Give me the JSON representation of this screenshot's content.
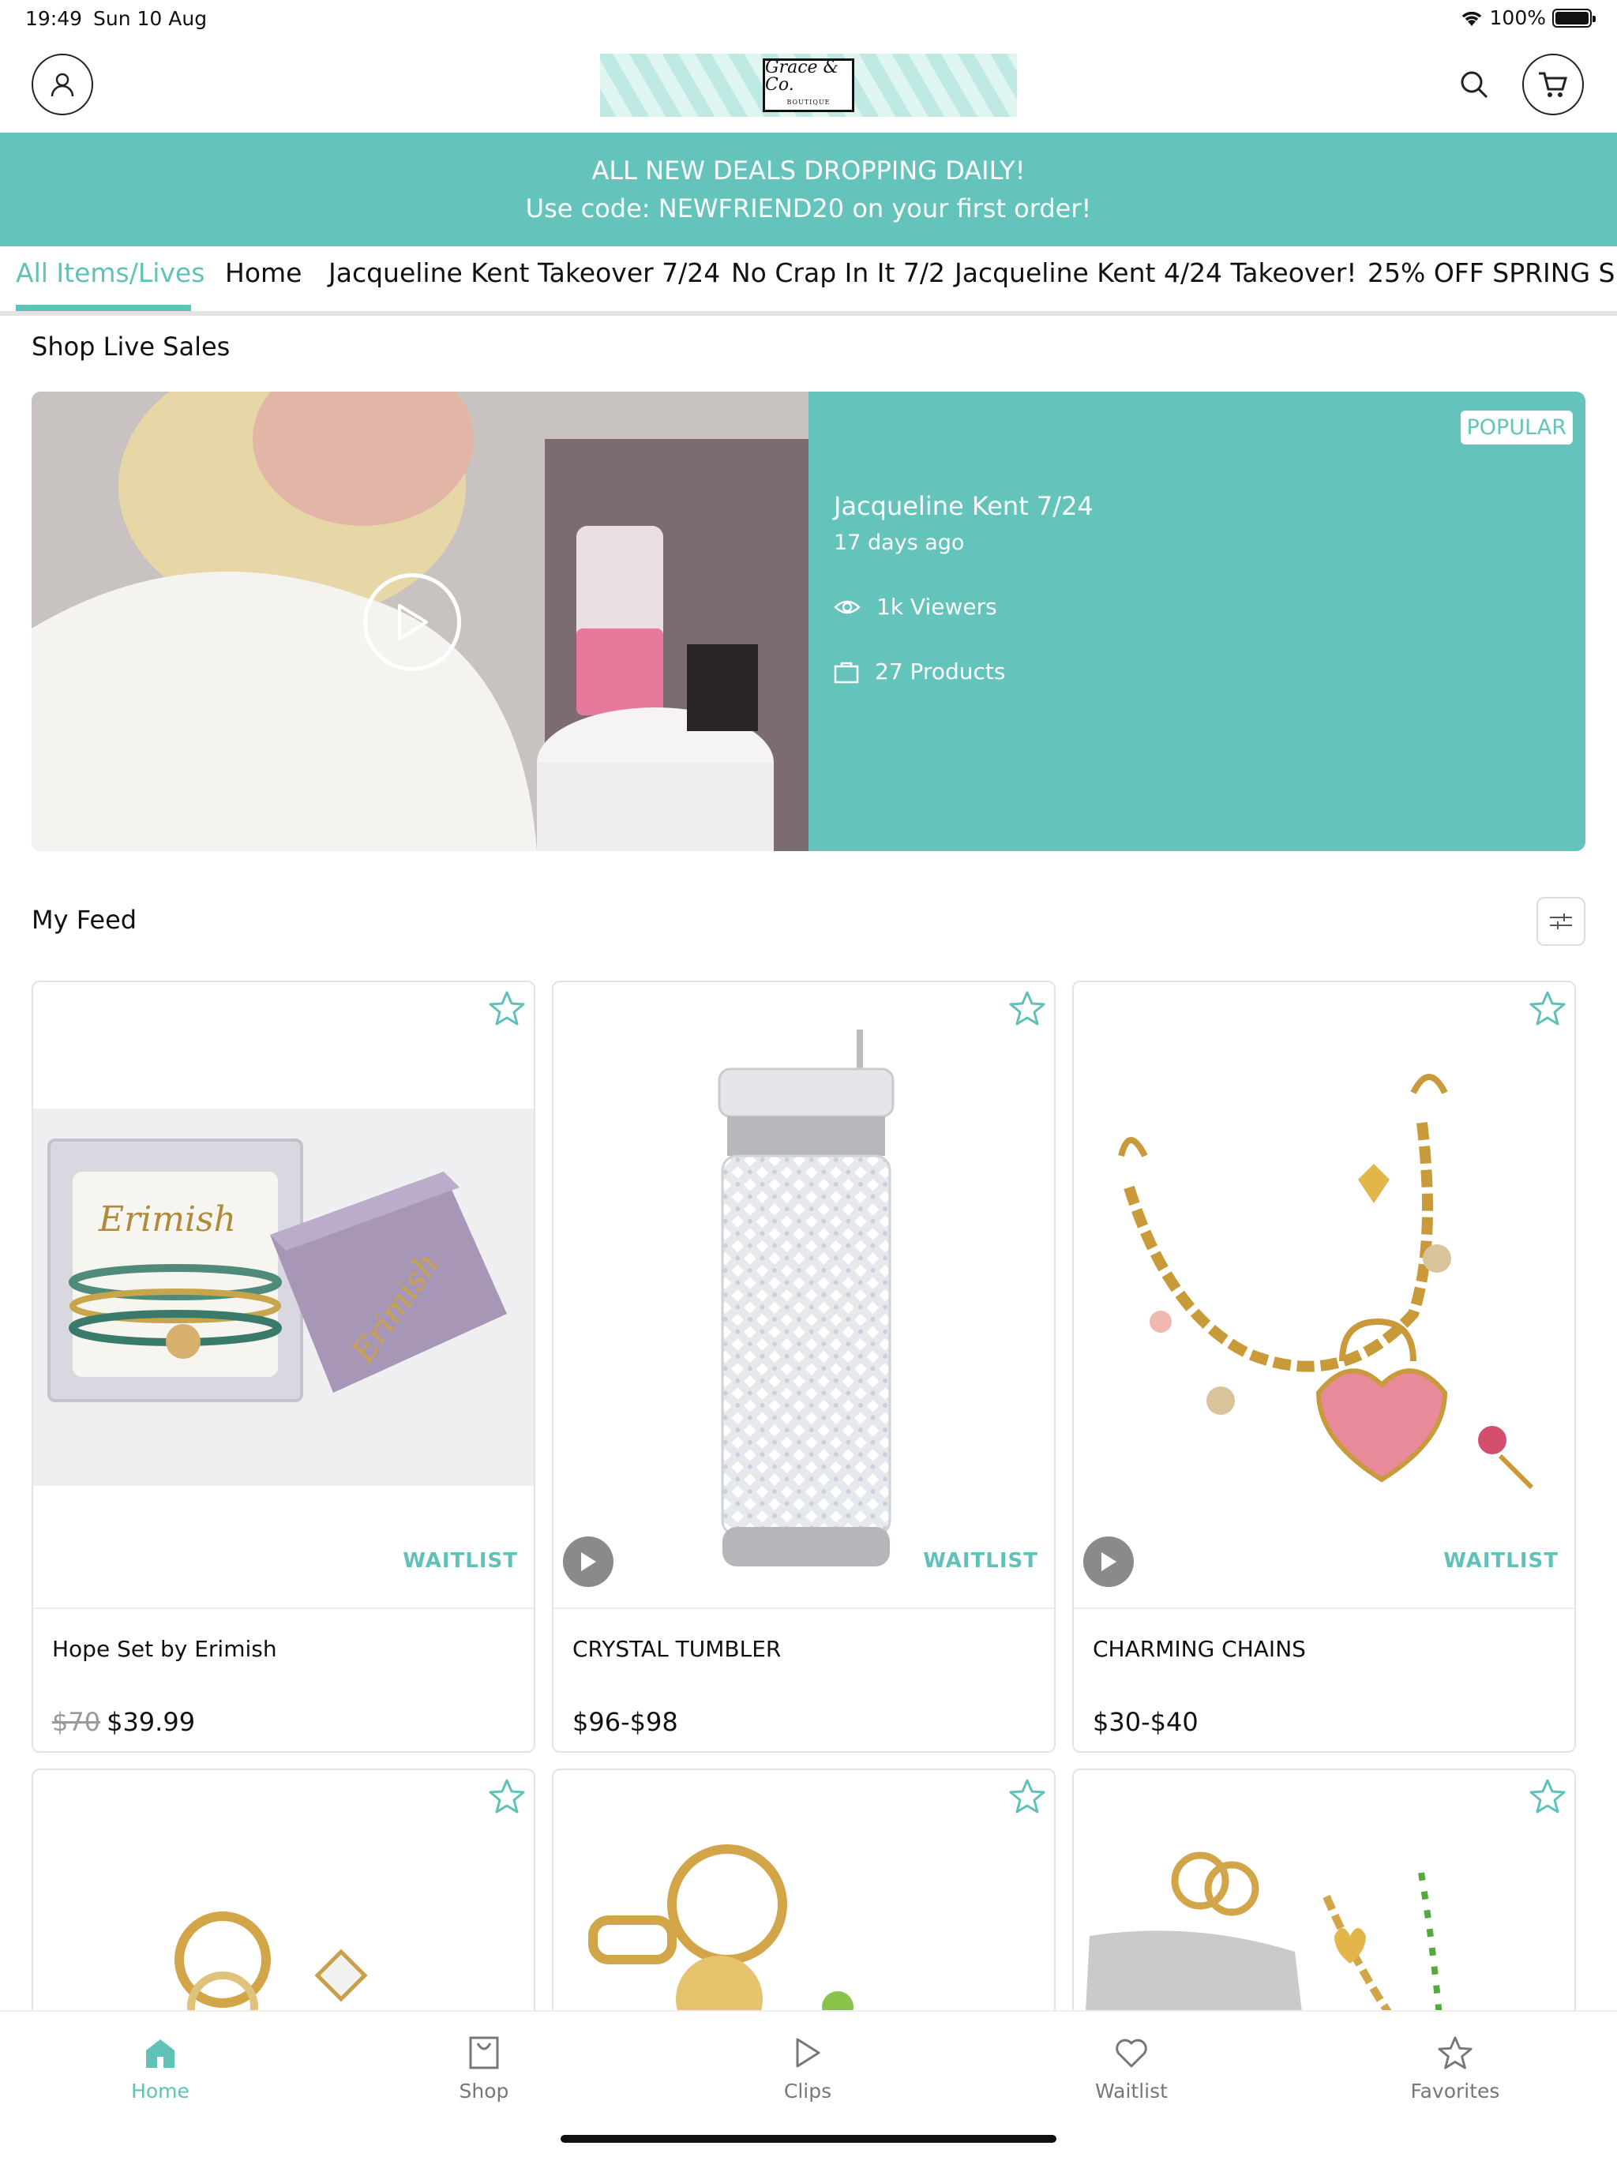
{
  "status_bar": {
    "time": "19:49",
    "date": "Sun 10 Aug",
    "battery": "100%"
  },
  "header": {
    "logo_text": "Grace & Co.",
    "logo_sub": "BOUTIQUE"
  },
  "promo": {
    "line1": "ALL NEW DEALS DROPPING DAILY!",
    "line2": "Use code: NEWFRIEND20 on your first order!"
  },
  "tabs": [
    "All Items/Lives",
    "Home",
    "Jacqueline Kent Takeover 7/24",
    "No Crap In It 7/2",
    "Jacqueline Kent 4/24 Takeover!",
    "25% OFF SPRING SHO"
  ],
  "live_section": {
    "title": "Shop Live Sales",
    "badge": "POPULAR",
    "show_title": "Jacqueline Kent 7/24",
    "ago": "17 days ago",
    "viewers": "1k Viewers",
    "products": "27 Products"
  },
  "feed": {
    "title": "My Feed",
    "waitlist_label": "WAITLIST",
    "cards": [
      {
        "name": "Hope Set by Erimish",
        "old_price": "$70",
        "price": "$39.99",
        "img_text": "Erimish"
      },
      {
        "name": "CRYSTAL TUMBLER",
        "old_price": "",
        "price": "$96-$98"
      },
      {
        "name": "CHARMING CHAINS",
        "old_price": "",
        "price": "$30-$40"
      }
    ]
  },
  "bottom_nav": [
    "Home",
    "Shop",
    "Clips",
    "Waitlist",
    "Favorites"
  ],
  "colors": {
    "accent": "#64c4bb",
    "accent_text": "#5fc1b8"
  }
}
